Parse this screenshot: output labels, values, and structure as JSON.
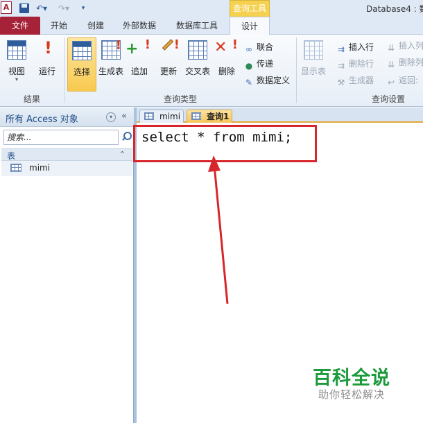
{
  "app": {
    "logo_letter": "A",
    "window_title": "Database4 : 数",
    "context_tab_title": "查询工具"
  },
  "quick_access": {
    "undo_glyph": "↶▾",
    "redo_glyph": "↷▾",
    "more_glyph": "▾"
  },
  "tabs": {
    "file": "文件",
    "home": "开始",
    "create": "创建",
    "external": "外部数据",
    "dbtools": "数据库工具",
    "design": "设计"
  },
  "ribbon": {
    "results": {
      "view": "视图",
      "view_arrow": "▾",
      "run": "运行",
      "label": "结果"
    },
    "query_type": {
      "select": "选择",
      "make_table": "生成表",
      "append": "追加",
      "update": "更新",
      "crosstab": "交叉表",
      "delete": "删除",
      "union": "联合",
      "pass_through": "传递",
      "data_definition": "数据定义",
      "label": "查询类型"
    },
    "query_setup": {
      "show_table": "显示表",
      "insert_rows": "插入行",
      "delete_rows": "删除行",
      "builder": "生成器",
      "insert_columns": "插入列",
      "delete_columns": "删除列",
      "return": "返回:",
      "label": "查询设置"
    }
  },
  "nav": {
    "title": "所有 Access 对象",
    "menu_glyph": "▾",
    "collapse_glyph": "«",
    "search_placeholder": "搜索...",
    "group_label": "表",
    "group_toggle": "⌃",
    "items": [
      {
        "label": "mimi"
      }
    ]
  },
  "document": {
    "tabs": [
      {
        "label": "mimi"
      },
      {
        "label": "查询1"
      }
    ],
    "sql": "select * from mimi;"
  },
  "annotation": {
    "color": "#d7262b"
  },
  "watermark": {
    "title": "百科全说",
    "subtitle": "助你轻松解决"
  }
}
